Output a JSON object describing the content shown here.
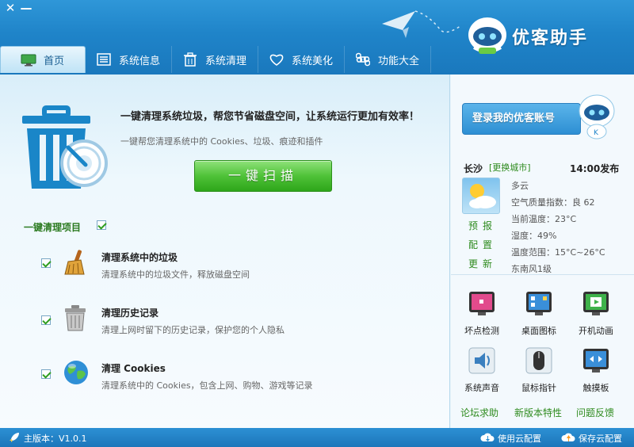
{
  "window": {
    "close_label": "✕",
    "minimize_label": "—",
    "app_name": "优客助手"
  },
  "nav": {
    "tabs": [
      {
        "label": "首页",
        "icon": "monitor-icon"
      },
      {
        "label": "系统信息",
        "icon": "list-icon"
      },
      {
        "label": "系统清理",
        "icon": "trash-icon"
      },
      {
        "label": "系统美化",
        "icon": "heart-icon"
      },
      {
        "label": "功能大全",
        "icon": "command-icon"
      }
    ]
  },
  "main": {
    "headline": "一键清理系统垃圾，帮您节省磁盘空间，让系统运行更加有效率！",
    "subline": "一键帮您清理系统中的 Cookies、垃圾、痕迹和插件",
    "scan_button": "一键扫描",
    "section_title": "一键清理项目",
    "items": [
      {
        "title": "清理系统中的垃圾",
        "desc": "清理系统中的垃圾文件，释放磁盘空间",
        "icon": "broom-icon",
        "checked": true
      },
      {
        "title": "清理历史记录",
        "desc": "清理上网时留下的历史记录，保护您的个人隐私",
        "icon": "trash-can-icon",
        "checked": true
      },
      {
        "title": "清理 Cookies",
        "desc": "清理系统中的 Cookies，包含上网、购物、游戏等记录",
        "icon": "globe-icon",
        "checked": true
      }
    ]
  },
  "right": {
    "login_label": "登录我的优客账号",
    "city": "长沙",
    "change_city": "[更换城市]",
    "publish_time": "14:00发布",
    "weather_links": [
      "预报",
      "配置",
      "更新"
    ],
    "weather_lines": [
      "多云",
      "空气质量指数：良 62",
      "当前温度：23°C",
      "湿度：49%",
      "温度范围：15°C~26°C",
      "东南风1级"
    ],
    "tools": [
      {
        "label": "坏点检测",
        "icon": "pixel-test-icon"
      },
      {
        "label": "桌面图标",
        "icon": "desktop-icons-icon"
      },
      {
        "label": "开机动画",
        "icon": "boot-animation-icon"
      },
      {
        "label": "系统声音",
        "icon": "speaker-icon"
      },
      {
        "label": "鼠标指针",
        "icon": "mouse-icon"
      },
      {
        "label": "触摸板",
        "icon": "touchpad-icon"
      }
    ],
    "bottom_links": [
      "论坛求助",
      "新版本特性",
      "问题反馈"
    ]
  },
  "status": {
    "version": "主版本：V1.0.1",
    "use_cloud": "使用云配置",
    "save_cloud": "保存云配置"
  },
  "colors": {
    "title_bar": "#1f84c9",
    "accent_green": "#4fc238",
    "link_green": "#2e8b1e"
  }
}
